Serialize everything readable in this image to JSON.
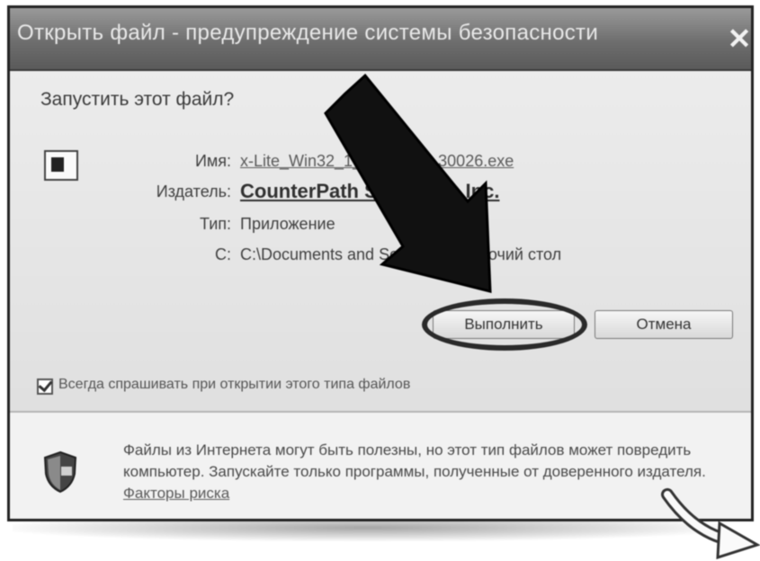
{
  "dialog": {
    "title": "Открыть файл - предупреждение системы безопасности",
    "close_glyph": "✕",
    "question": "Запустить этот файл?",
    "icons": {
      "file": "application-file-icon",
      "shield": "security-shield-icon",
      "arrow": "pointer-arrow-icon",
      "curved_arrow": "curved-arrow-icon"
    },
    "fields": {
      "name_label": "Имя:",
      "name_value": "x-Lite_Win32_1_..._50140_30026.exe",
      "publisher_label": "Издатель:",
      "publisher_value": "CounterPath Solutions, Inc.",
      "type_label": "Тип:",
      "type_value": "Приложение",
      "from_label": "С:",
      "from_value": "C:\\Documents and Settings\\...\\Рабочий стол"
    },
    "buttons": {
      "run": "Выполнить",
      "cancel": "Отмена"
    },
    "checkbox_label": "Всегда спрашивать при открытии этого типа файлов",
    "warning_text": "Файлы из Интернета могут быть полезны, но этот тип файлов может повредить компьютер. Запускайте только программы, полученные от доверенного издателя.",
    "warning_link": "Факторы риска"
  }
}
